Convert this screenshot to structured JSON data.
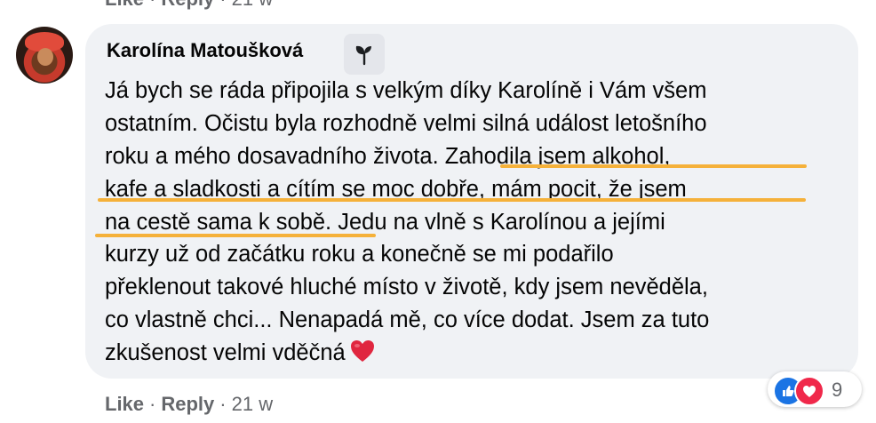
{
  "previous_comment": {
    "like_label": "Like",
    "reply_label": "Reply",
    "separator": "·",
    "time": "21 w"
  },
  "comment": {
    "author": "Karolína Matoušková",
    "badge_icon": "plant-sprout-icon",
    "lines": [
      "Já bych se ráda připojila s velkým díky Karolíně i Vám všem",
      "ostatním. Očistu byla rozhodně velmi silná událost letošního",
      "roku a mého dosavadního života. Zahodila jsem alkohol,",
      "kafe a sladkosti a cítím se moc dobře, mám pocit, že jsem",
      "na cestě sama k sobě. Jedu na vlně s Karolínou a jejími",
      "kurzy už od začátku roku a konečně se mi podařilo",
      "překlenout takové hluché místo v životě, kdy jsem nevěděla,",
      "co vlastně chci... Nenapadá mě, co více dodat. Jsem za tuto",
      "zkušenost velmi vděčná"
    ],
    "emoji": "red-heart-icon",
    "highlight_color": "#f5b13a"
  },
  "actions": {
    "like_label": "Like",
    "reply_label": "Reply",
    "separator": "·",
    "time": "21 w"
  },
  "reactions": {
    "icons": [
      "like-reaction-icon",
      "love-reaction-icon"
    ],
    "count": "9",
    "like_color": "#1b74e4",
    "love_color": "#f0284a"
  }
}
